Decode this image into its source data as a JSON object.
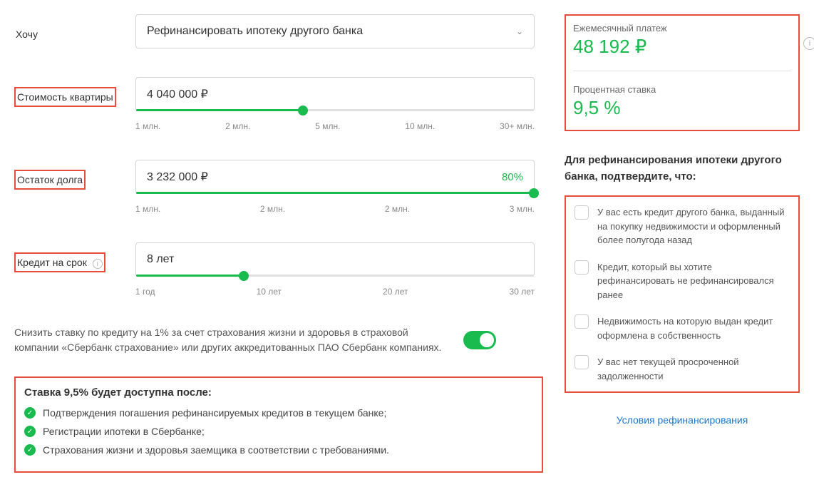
{
  "form": {
    "want": {
      "label": "Хочу",
      "value": "Рефинансировать ипотеку другого банка"
    },
    "price": {
      "label": "Стоимость квартиры",
      "value": "4 040 000 ₽",
      "ticks": [
        "1 млн.",
        "2 млн.",
        "5 млн.",
        "10 млн.",
        "30+ млн."
      ],
      "fill_pct": 42
    },
    "debt": {
      "label": "Остаток долга",
      "value": "3 232 000 ₽",
      "pct": "80%",
      "ticks": [
        "1 млн.",
        "2 млн.",
        "2 млн.",
        "3 млн."
      ],
      "fill_pct": 100
    },
    "term": {
      "label": "Кредит на срок",
      "value": "8 лет",
      "ticks": [
        "1 год",
        "10 лет",
        "20 лет",
        "30 лет"
      ],
      "fill_pct": 27
    }
  },
  "insurance": {
    "text": "Снизить ставку по кредиту на 1% за счет страхования жизни и здоровья в страховой компании «Сбербанк страхование» или других аккредитованных ПАО Сбербанк компаниях.",
    "enabled": true
  },
  "rate_info": {
    "title": "Ставка 9,5% будет доступна после:",
    "items": [
      "Подтверждения погашения рефинансируемых кредитов в текущем банке;",
      "Регистрации ипотеки в Сбербанке;",
      "Страхования жизни и здоровья заемщика в соответствии с требованиями."
    ]
  },
  "summary": {
    "payment_label": "Ежемесячный платеж",
    "payment_value": "48 192 ₽",
    "rate_label": "Процентная ставка",
    "rate_value": "9,5 %"
  },
  "confirm": {
    "title": "Для рефинансирования ипотеки другого банка, подтвердите, что:",
    "items": [
      "У вас есть кредит другого банка, выданный на покупку недвижимости и оформленный более полугода назад",
      "Кредит, который вы хотите рефинансировать не рефинансировался ранее",
      "Недвижимость на которую выдан кредит оформлена в собственность",
      "У вас нет текущей просроченной задолженности"
    ]
  },
  "terms_link": "Условия рефинансирования"
}
